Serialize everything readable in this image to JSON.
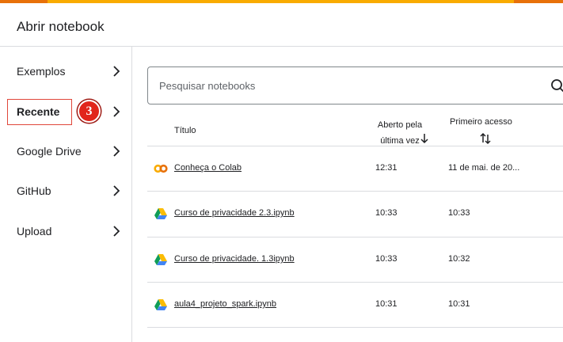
{
  "dialog": {
    "title": "Abrir notebook"
  },
  "sidebar": {
    "items": [
      {
        "label": "Exemplos"
      },
      {
        "label": "Recente"
      },
      {
        "label": "Google Drive"
      },
      {
        "label": "GitHub"
      },
      {
        "label": "Upload"
      }
    ],
    "selected": "Recente",
    "badge": "3"
  },
  "search": {
    "placeholder": "Pesquisar notebooks"
  },
  "table": {
    "headers": {
      "title": "Título",
      "last_opened_line1": "Aberto pela",
      "last_opened_line2": "última vez",
      "first_opened": "Primeiro acesso"
    },
    "rows": [
      {
        "icon": "colab-icon",
        "name": "Conheça o Colab",
        "last_opened": "12:31",
        "first_opened": "11 de mai. de 20..."
      },
      {
        "icon": "google-drive-icon",
        "name": "Curso de privacidade 2.3.ipynb",
        "last_opened": "10:33",
        "first_opened": "10:33"
      },
      {
        "icon": "google-drive-icon",
        "name": "Curso de privacidade. 1.3ipynb",
        "last_opened": "10:33",
        "first_opened": "10:32"
      },
      {
        "icon": "google-drive-icon",
        "name": "aula4_projeto_spark.ipynb",
        "last_opened": "10:31",
        "first_opened": "10:31"
      }
    ]
  },
  "colors": {
    "accent_orange": "#f9ab00",
    "accent_dark_orange": "#e8710a",
    "badge_red": "#e1251b",
    "divider": "#dadce0"
  }
}
